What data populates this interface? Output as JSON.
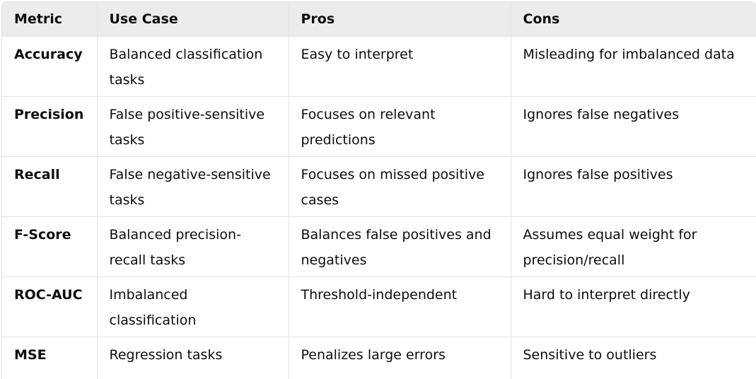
{
  "table": {
    "headers": [
      "Metric",
      "Use Case",
      "Pros",
      "Cons"
    ],
    "rows": [
      {
        "metric": "Accuracy",
        "use_case": "Balanced classification tasks",
        "pros": "Easy to interpret",
        "cons": "Misleading for imbalanced data"
      },
      {
        "metric": "Precision",
        "use_case": "False positive-sensitive tasks",
        "pros": "Focuses on relevant predictions",
        "cons": "Ignores false negatives"
      },
      {
        "metric": "Recall",
        "use_case": "False negative-sensitive tasks",
        "pros": "Focuses on missed positive cases",
        "cons": "Ignores false positives"
      },
      {
        "metric": "F-Score",
        "use_case": "Balanced precision-recall tasks",
        "pros": "Balances false positives and negatives",
        "cons": "Assumes equal weight for precision/recall"
      },
      {
        "metric": "ROC-AUC",
        "use_case": "Imbalanced classification",
        "pros": "Threshold-independent",
        "cons": "Hard to interpret directly"
      },
      {
        "metric": "MSE",
        "use_case": "Regression tasks",
        "pros": "Penalizes large errors",
        "cons": "Sensitive to outliers"
      }
    ]
  }
}
